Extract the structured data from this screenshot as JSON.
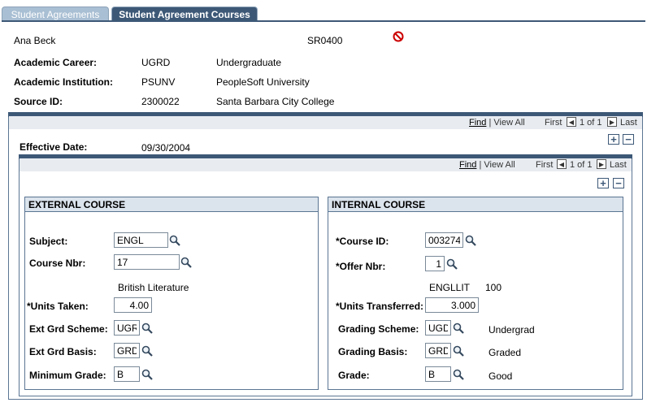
{
  "tabs": [
    {
      "label": "Student Agreements",
      "active": false
    },
    {
      "label": "Student Agreement Courses",
      "active": true
    }
  ],
  "header": {
    "student_name": "Ana Beck",
    "agreement_id": "SR0400",
    "career_label": "Academic Career:",
    "career_code": "UGRD",
    "career_desc": "Undergraduate",
    "institution_label": "Academic Institution:",
    "institution_code": "PSUNV",
    "institution_desc": "PeopleSoft University",
    "source_label": "Source ID:",
    "source_code": "2300022",
    "source_desc": "Santa Barbara City College"
  },
  "outer_nav": {
    "find": "Find",
    "sep": " | ",
    "view_all": "View All",
    "first": "First",
    "count": "1 of 1",
    "last": "Last"
  },
  "effective_date": {
    "label": "Effective Date:",
    "value": "09/30/2004"
  },
  "inner_nav": {
    "find": "Find",
    "sep": " | ",
    "view_all": "View All",
    "first": "First",
    "count": "1 of 1",
    "last": "Last"
  },
  "buttons": {
    "add": "+",
    "remove": "−"
  },
  "external": {
    "title": "EXTERNAL COURSE",
    "subject_label": "Subject:",
    "subject": "ENGL",
    "course_nbr_label": "Course Nbr:",
    "course_nbr": "17",
    "course_title": "British Literature",
    "units_taken_label": "*Units Taken:",
    "units_taken": "4.00",
    "grd_scheme_label": "Ext Grd Scheme:",
    "grd_scheme": "UGR",
    "grd_basis_label": "Ext Grd Basis:",
    "grd_basis": "GRD",
    "min_grade_label": "Minimum Grade:",
    "min_grade": "B"
  },
  "internal": {
    "title": "INTERNAL COURSE",
    "course_id_label": "*Course ID:",
    "course_id": "003274",
    "offer_nbr_label": "*Offer Nbr:",
    "offer_nbr": "1",
    "subject_code": "ENGLLIT",
    "catalog_nbr": "100",
    "units_trans_label": "*Units Transferred:",
    "units_trans": "3.000",
    "grading_scheme_label": "Grading Scheme:",
    "grading_scheme": "UGD",
    "grading_scheme_desc": "Undergrad",
    "grading_basis_label": "Grading Basis:",
    "grading_basis": "GRD",
    "grading_basis_desc": "Graded",
    "grade_label": "Grade:",
    "grade": "B",
    "grade_desc": "Good"
  },
  "colors": {
    "accent": "#3d5877",
    "tab_inactive": "#a9bfd3",
    "group_header": "#dbe3ec",
    "stop": "#cc0000"
  }
}
